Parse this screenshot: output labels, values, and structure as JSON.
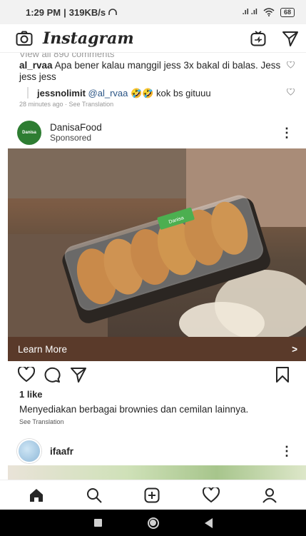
{
  "status": {
    "time": "1:29 PM",
    "speed": "319KB/s",
    "signal": ".ıl .ıl",
    "battery": "68"
  },
  "topbar": {
    "title": "Instagram"
  },
  "comments": {
    "view_all": "View all 890 comments",
    "first_user": "al_rvaa",
    "first_text": "Apa bener kalau manggil jess 3x bakal di balas. Jess jess jess",
    "reply_user": "jessnolimit",
    "reply_mention": "@al_rvaa",
    "reply_text": "🤣🤣 kok bs gituuu",
    "meta": "28 minutes ago · See Translation"
  },
  "post": {
    "avatar_text": "Danisa",
    "username": "DanisaFood",
    "sponsored": "Sponsored",
    "product_label": "Danisa",
    "cta": "Learn More",
    "cta_chevron": ">",
    "likes": "1 like",
    "caption": "Menyediakan berbagai brownies dan cemilan lainnya.",
    "see_translation": "See Translation"
  },
  "post2": {
    "username": "ifaafr"
  },
  "nav": [
    "home-icon",
    "search-icon",
    "add-icon",
    "heart-icon",
    "profile-icon"
  ]
}
